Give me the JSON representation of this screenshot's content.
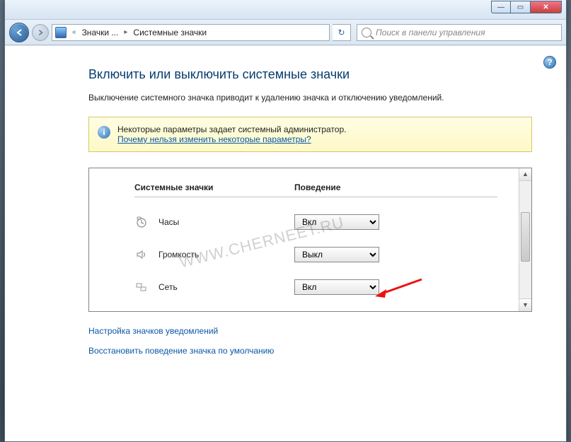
{
  "titlebar": {
    "minimize_glyph": "—",
    "maximize_glyph": "▭",
    "close_glyph": "✕"
  },
  "breadcrumb": {
    "chevrons": "«",
    "item1": "Значки ...",
    "sep": "▸",
    "item2": "Системные значки"
  },
  "refresh_glyph": "↻",
  "search": {
    "placeholder": "Поиск в панели управления"
  },
  "help_glyph": "?",
  "page": {
    "title": "Включить или выключить системные значки",
    "description": "Выключение системного значка приводит к удалению значка и отключению уведомлений."
  },
  "info": {
    "text": "Некоторые параметры задает системный администратор.",
    "link": "Почему нельзя изменить некоторые параметры?"
  },
  "table": {
    "col_icons": "Системные значки",
    "col_behavior": "Поведение",
    "rows": [
      {
        "label": "Часы",
        "value": "Вкл"
      },
      {
        "label": "Громкость",
        "value": "Выкл"
      },
      {
        "label": "Сеть",
        "value": "Вкл"
      }
    ],
    "options": {
      "on": "Вкл",
      "off": "Выкл"
    }
  },
  "links": {
    "customize": "Настройка значков уведомлений",
    "restore": "Восстановить поведение значка по умолчанию"
  },
  "watermark": "WWW.CHERNEET.RU"
}
